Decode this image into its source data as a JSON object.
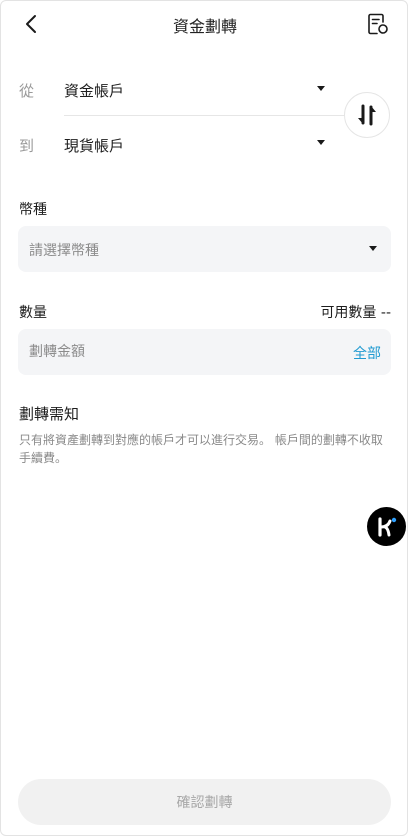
{
  "header": {
    "title": "資金劃轉",
    "back_icon": "chevron-left-icon",
    "record_icon": "document-clock-icon"
  },
  "transfer": {
    "from_label": "從",
    "from_value": "資金帳戶",
    "to_label": "到",
    "to_value": "現貨帳戶",
    "swap_icon": "swap-vertical-icon"
  },
  "currency": {
    "label": "幣種",
    "placeholder": "請選擇幣種"
  },
  "amount": {
    "label": "數量",
    "available": "可用數量 --",
    "placeholder": "劃轉金額",
    "all_label": "全部"
  },
  "notice": {
    "title": "劃轉需知",
    "body": "只有將資產劃轉到對應的帳戶才可以進行交易。 帳戶間的劃轉不收取手續費。"
  },
  "floating": {
    "icon": "k-logo-icon"
  },
  "footer": {
    "confirm_label": "確認劃轉"
  },
  "colors": {
    "accent": "#1f9ad1",
    "field_bg": "#f4f5f7",
    "muted": "#8c8c8c"
  }
}
